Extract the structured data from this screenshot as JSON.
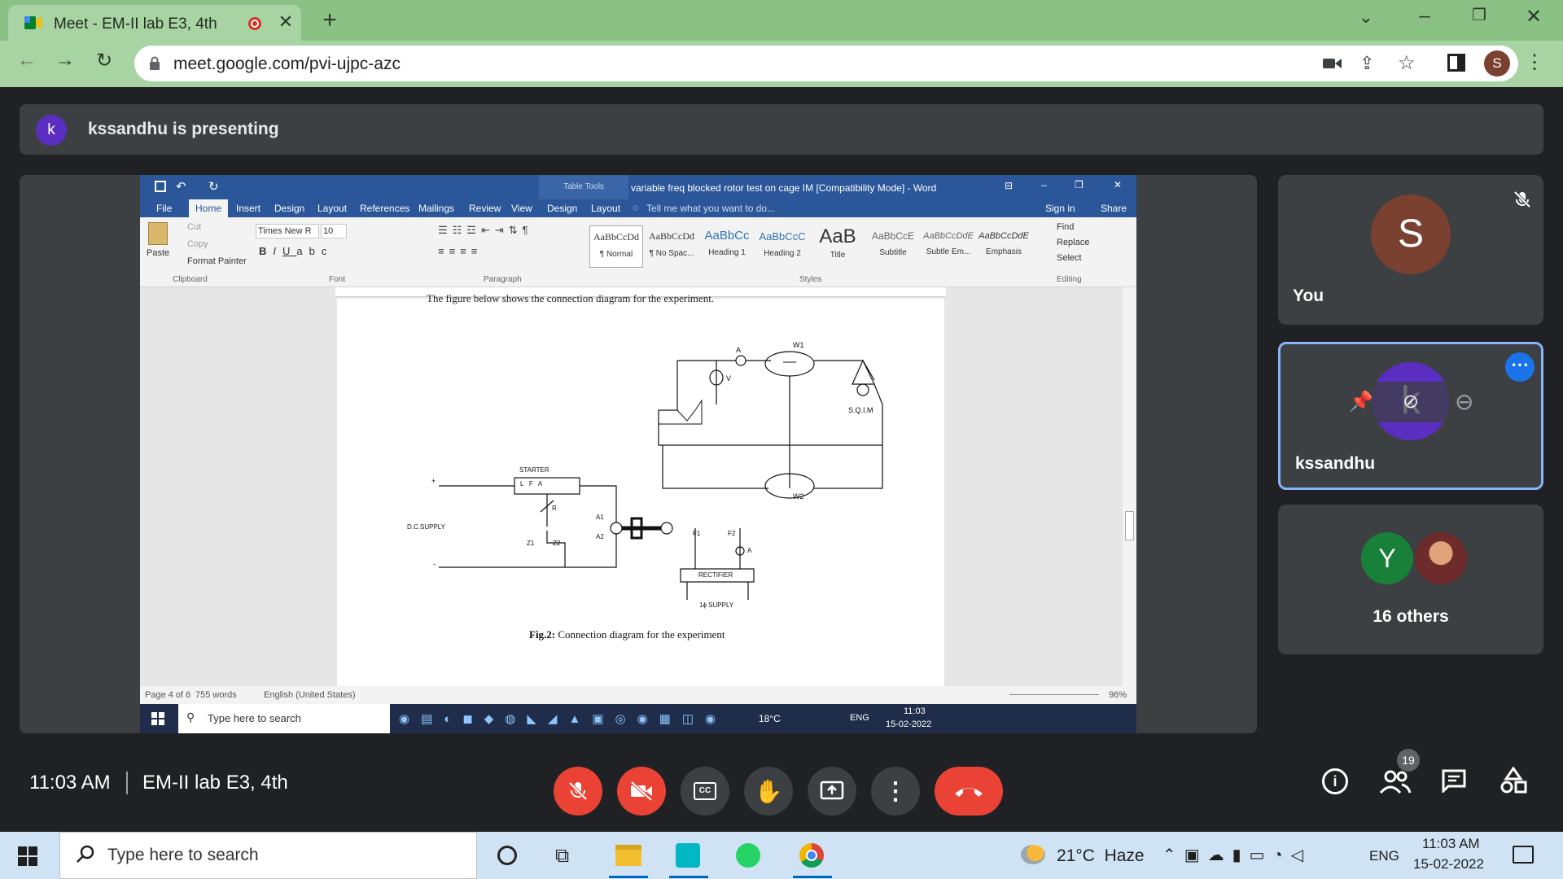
{
  "browser": {
    "tab_title": "Meet - EM-II lab E3, 4th",
    "url": "meet.google.com/pvi-ujpc-azc",
    "profile_initial": "S"
  },
  "presenting": {
    "avatar_initial": "k",
    "text": "kssandhu is presenting"
  },
  "word": {
    "table_tools": "Table Tools",
    "title": "variable freq blocked rotor test on cage IM [Compatibility Mode] - Word",
    "tabs": [
      "File",
      "Home",
      "Insert",
      "Design",
      "Layout",
      "References",
      "Mailings",
      "Review",
      "View",
      "Design",
      "Layout"
    ],
    "tell_me": "Tell me what you want to do...",
    "sign_in": "Sign in",
    "share": "Share",
    "clipboard": {
      "paste": "Paste",
      "cut": "Cut",
      "copy": "Copy",
      "format_painter": "Format Painter",
      "group": "Clipboard"
    },
    "font": {
      "name": "Times New R",
      "size": "10",
      "group": "Font"
    },
    "paragraph_group": "Paragraph",
    "styles": [
      {
        "sample": "AaBbCcDd",
        "name": "¶ Normal"
      },
      {
        "sample": "AaBbCcDd",
        "name": "¶ No Spac..."
      },
      {
        "sample": "AaBbCc",
        "name": "Heading 1"
      },
      {
        "sample": "AaBbCcC",
        "name": "Heading 2"
      },
      {
        "sample": "AaB",
        "name": "Title"
      },
      {
        "sample": "AaBbCcE",
        "name": "Subtitle"
      },
      {
        "sample": "AaBbCcDdE",
        "name": "Subtle Em..."
      },
      {
        "sample": "AaBbCcDdE",
        "name": "Emphasis"
      }
    ],
    "styles_group": "Styles",
    "editing": {
      "find": "Find",
      "replace": "Replace",
      "select": "Select",
      "group": "Editing"
    },
    "doc": {
      "top_text": "The figure below shows the connection diagram for the experiment.",
      "caption_bold": "Fig.2:",
      "caption_rest": " Connection diagram for the experiment",
      "labels": {
        "w1": "W1",
        "w2": "W2",
        "a": "A",
        "v": "V",
        "sqim": "S.Q.I.M",
        "starter": "STARTER",
        "lfa": "L   F   A",
        "dc_supply": "D.C.SUPPLY",
        "r": "R",
        "z1": "Z1",
        "z2": "Z2",
        "a1": "A1",
        "a2": "A2",
        "f1": "F1",
        "f2": "F2",
        "a_meter": "A",
        "rectifier": "RECTIFIER",
        "supply_1ph": "1ϕ SUPPLY",
        "plus": "+",
        "minus": "-"
      }
    },
    "status": {
      "page": "Page 4 of 6",
      "words": "755 words",
      "lang": "English (United States)",
      "zoom": "96%"
    },
    "inner_taskbar": {
      "search": "Type here to search",
      "temp": "18°C",
      "lang": "ENG",
      "time": "11:03",
      "date": "15-02-2022"
    }
  },
  "participants": [
    {
      "initial": "S",
      "name": "You"
    },
    {
      "initial": "k",
      "name": "kssandhu"
    },
    {
      "initial": "Y",
      "name": "16 others"
    }
  ],
  "meeting": {
    "time": "11:03 AM",
    "name": "EM-II lab E3, 4th",
    "people_count": "19"
  },
  "taskbar": {
    "search": "Type here to search",
    "weather": "21°C  Haze",
    "lang": "ENG",
    "time": "11:03 AM",
    "date": "15-02-2022"
  },
  "colors": {
    "meet_bg": "#202124",
    "tile": "#3c4043",
    "end_call": "#ea4335",
    "chrome_green": "#a8d3a2",
    "word_blue": "#2b579a"
  }
}
